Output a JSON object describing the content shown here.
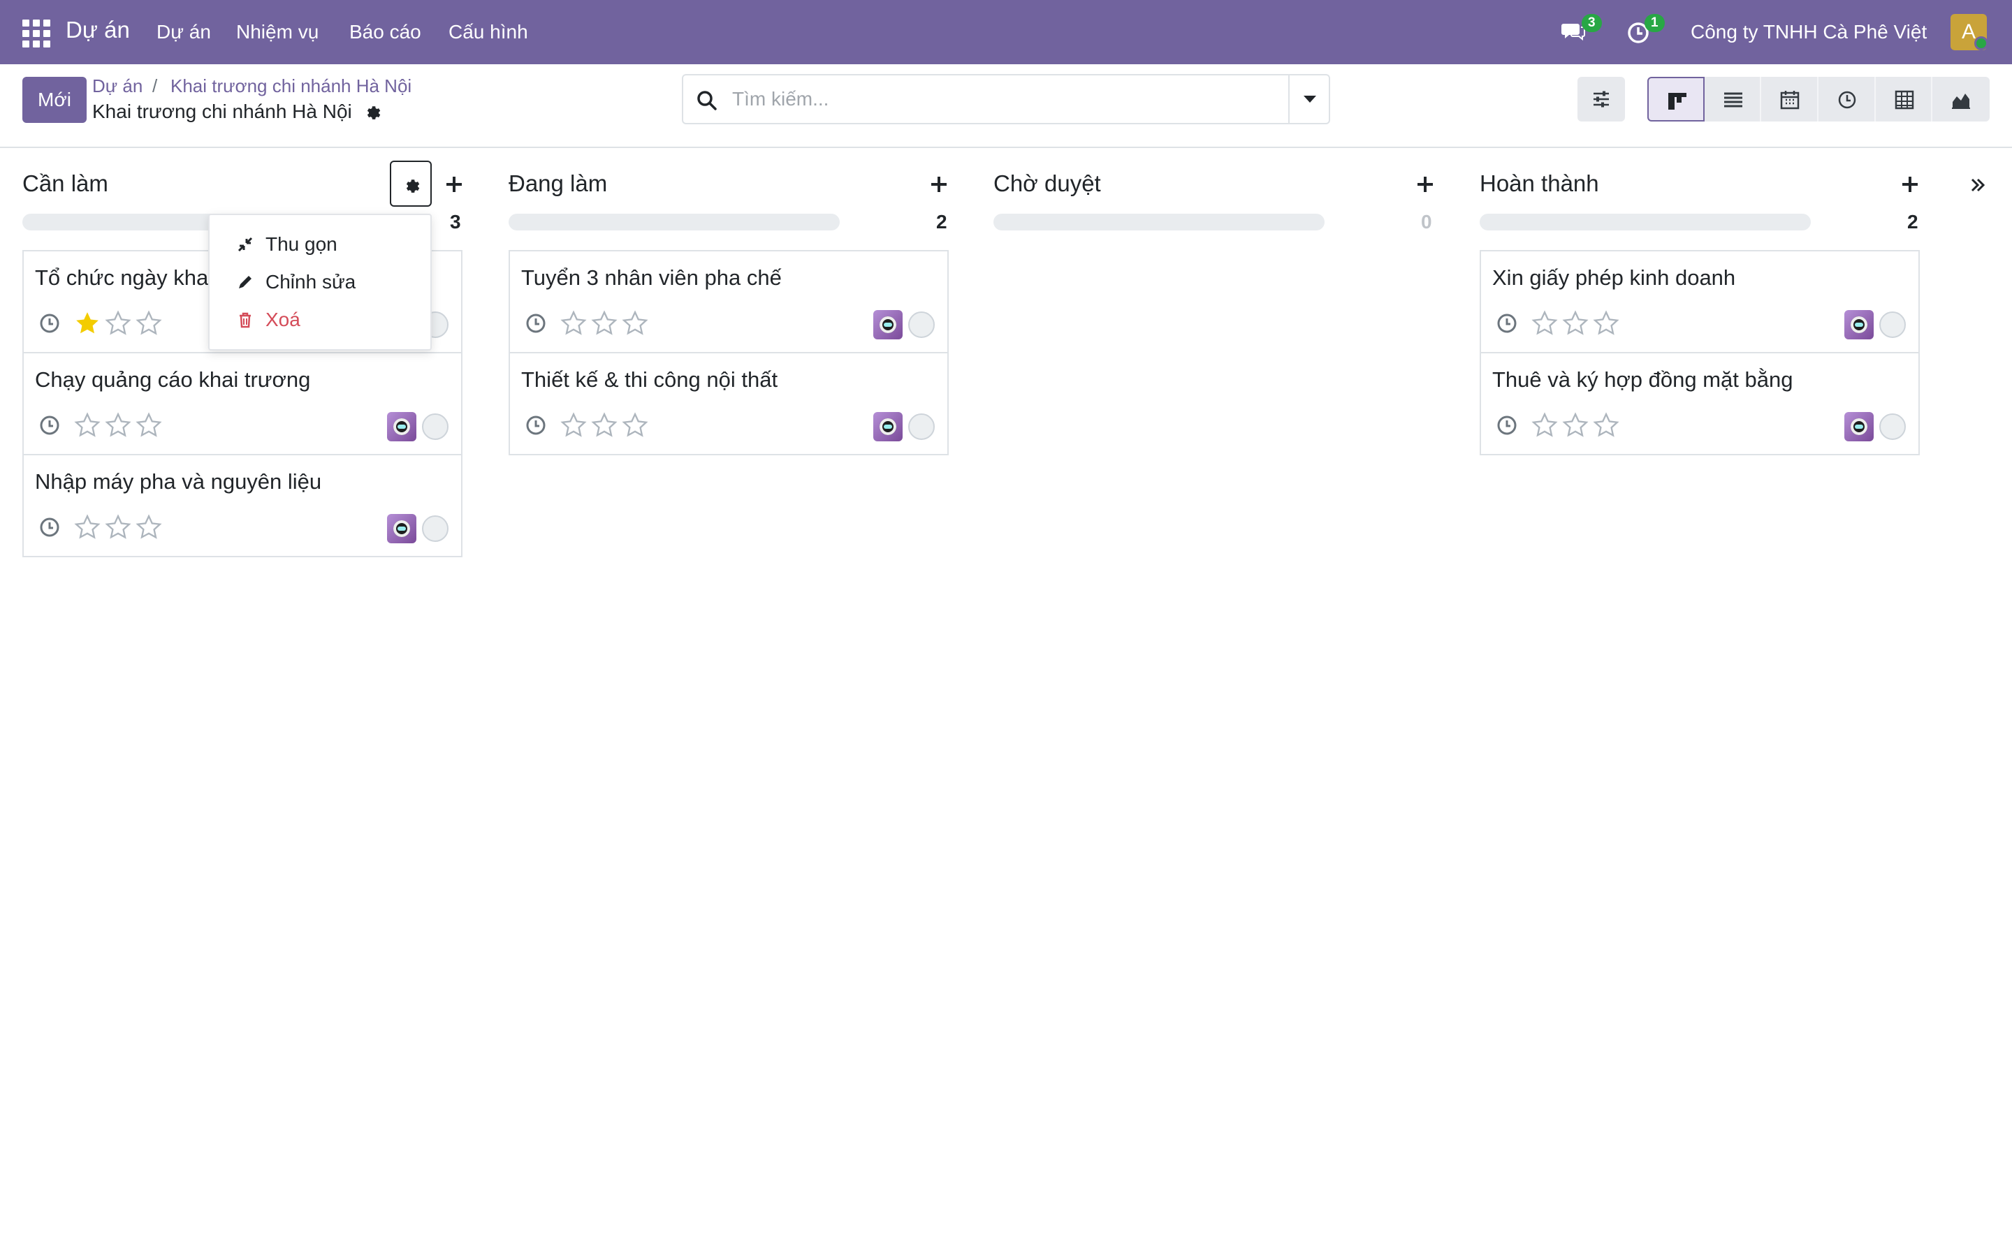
{
  "navbar": {
    "brand": "Dự án",
    "menu": [
      "Dự án",
      "Nhiệm vụ",
      "Báo cáo",
      "Cấu hình"
    ],
    "messages_count": "3",
    "activities_count": "1",
    "company": "Công ty TNHH Cà Phê Việt",
    "avatar_letter": "A"
  },
  "control_panel": {
    "new_button": "Mới",
    "breadcrumb": [
      "Dự án",
      "Khai trương chi nhánh Hà Nội"
    ],
    "breadcrumb_separator": "/",
    "current_title": "Khai trương chi nhánh Hà Nội",
    "search_placeholder": "Tìm kiếm..."
  },
  "columns": [
    {
      "title": "Cần làm",
      "count": "3",
      "cards": [
        {
          "title": "Tổ chức ngày khai trương",
          "stars": 1
        },
        {
          "title": "Chạy quảng cáo khai trương",
          "stars": 0
        },
        {
          "title": "Nhập máy pha và nguyên liệu",
          "stars": 0
        }
      ]
    },
    {
      "title": "Đang làm",
      "count": "2",
      "cards": [
        {
          "title": "Tuyển 3 nhân viên pha chế",
          "stars": 0
        },
        {
          "title": "Thiết kế & thi công nội thất",
          "stars": 0
        }
      ]
    },
    {
      "title": "Chờ duyệt",
      "count": "0",
      "cards": []
    },
    {
      "title": "Hoàn thành",
      "count": "2",
      "cards": [
        {
          "title": "Xin giấy phép kinh doanh",
          "stars": 0
        },
        {
          "title": "Thuê và ký hợp đồng mặt bằng",
          "stars": 0
        }
      ]
    }
  ],
  "column_menu": {
    "fold": "Thu gọn",
    "edit": "Chỉnh sửa",
    "delete": "Xoá"
  },
  "colors": {
    "brand": "#71639e",
    "star_active": "#f3cc00",
    "danger": "#d44c59",
    "badge": "#28a745"
  }
}
